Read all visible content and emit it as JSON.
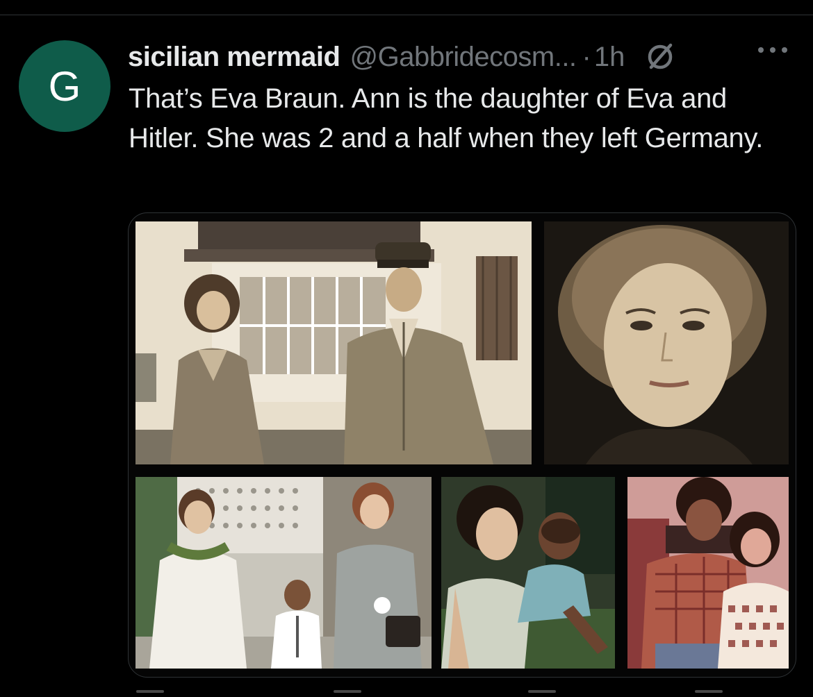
{
  "colors": {
    "background": "#000000",
    "avatar_bg": "#0f5c4a",
    "text_primary": "#e7e9ea",
    "text_secondary": "#71767b"
  },
  "tweet": {
    "avatar_letter": "G",
    "display_name": "sicilian mermaid",
    "handle": "@Gabbridecosm...",
    "separator": "·",
    "time": "1h",
    "text": "That’s Eva Braun. Ann is the daughter of Eva and Hitler. She was 2 and a half when they  left Germany.",
    "icons": {
      "grok": "grok-icon",
      "more": "more-options-icon"
    }
  },
  "media": {
    "photos": [
      {
        "name": "photo-couple-in-front-of-house",
        "tone": "sepia"
      },
      {
        "name": "photo-woman-portrait",
        "tone": "sepia"
      },
      {
        "name": "photo-family-with-child",
        "tone": "color"
      },
      {
        "name": "photo-woman-holding-toddler",
        "tone": "color"
      },
      {
        "name": "photo-young-man-and-woman",
        "tone": "faded-red"
      }
    ]
  }
}
